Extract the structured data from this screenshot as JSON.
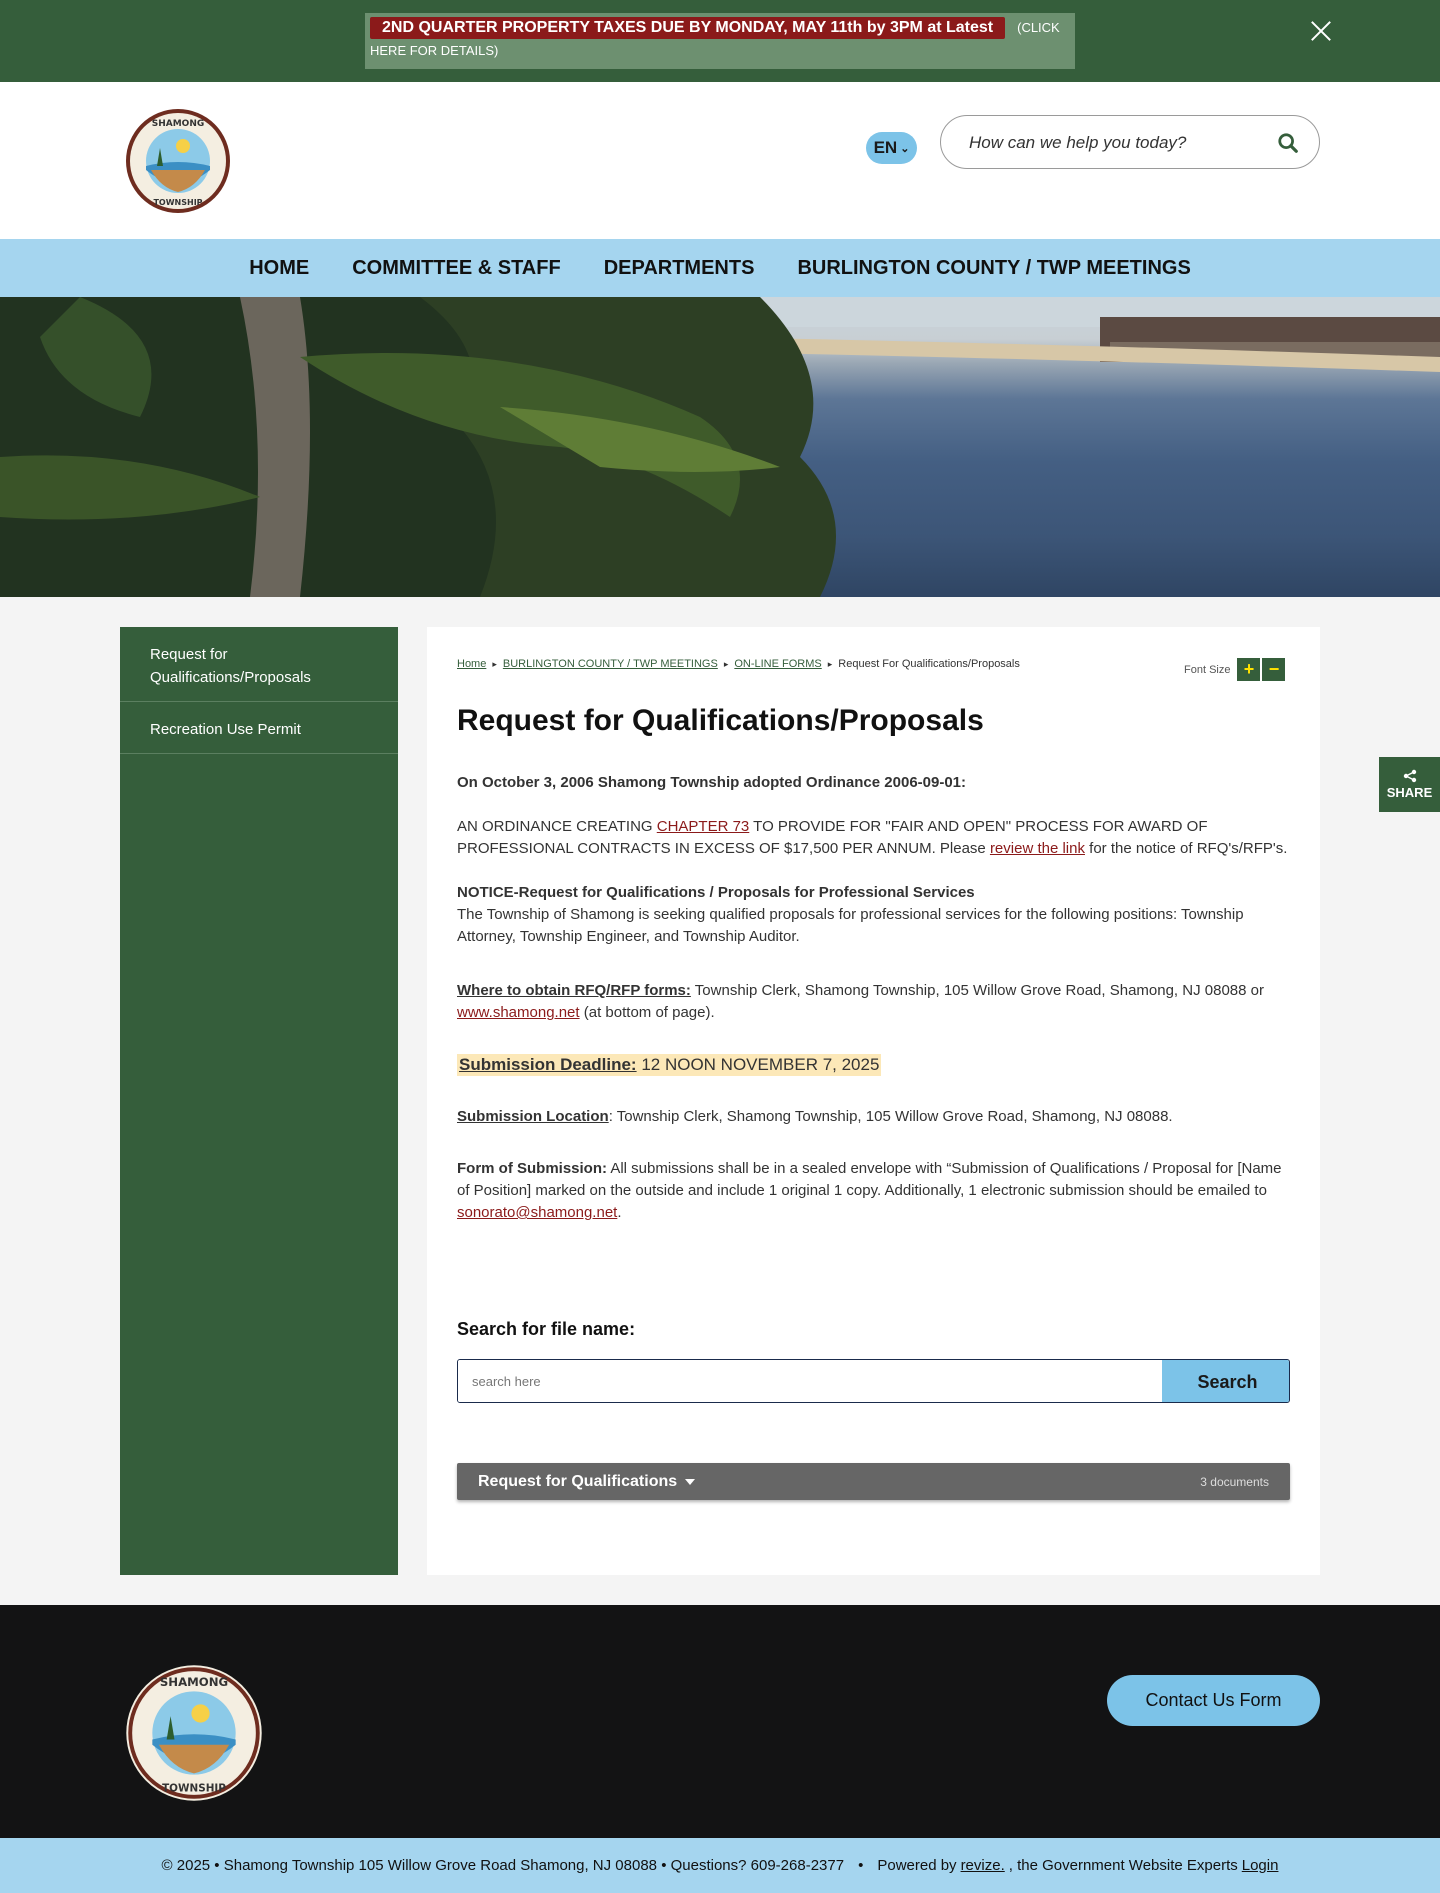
{
  "alert": {
    "badge": "2ND QUARTER PROPERTY TAXES DUE BY MONDAY, MAY 11th by 3PM at Latest",
    "click_text": "(CLICK",
    "line2": "HERE FOR DETAILS)"
  },
  "header": {
    "language": "EN",
    "search_placeholder": "How can we help you today?"
  },
  "nav": {
    "items": [
      "HOME",
      "COMMITTEE & STAFF",
      "DEPARTMENTS",
      "BURLINGTON COUNTY / TWP MEETINGS"
    ]
  },
  "sidebar": {
    "items": [
      "Request for Qualifications/Proposals",
      "Recreation Use Permit"
    ]
  },
  "breadcrumb": {
    "items": [
      "Home",
      "BURLINGTON COUNTY / TWP MEETINGS",
      "ON-LINE FORMS"
    ],
    "current": "Request For Qualifications/Proposals"
  },
  "font_size": {
    "label": "Font Size",
    "plus": "+",
    "minus": "−"
  },
  "page": {
    "title": "Request for Qualifications/Proposals",
    "intro": "On October 3, 2006 Shamong Township adopted Ordinance 2006-09-01:",
    "ord_pre": "AN ORDINANCE CREATING ",
    "ord_link": "CHAPTER 73",
    "ord_mid": " TO PROVIDE FOR \"FAIR AND OPEN\" PROCESS FOR AWARD OF PROFESSIONAL CONTRACTS IN EXCESS OF $17,500 PER ANNUM.  Please ",
    "ord_link2": "review the link",
    "ord_post": " for the notice of RFQ's/RFP's.",
    "notice_heading": "NOTICE-Request for Qualifications / Proposals for Professional Services",
    "notice_text": "The Township of Shamong is seeking qualified proposals for professional services for the following positions:  Township Attorney, Township Engineer, and Township Auditor.",
    "where_label": "Where to obtain RFQ/RFP forms:",
    "where_text": "  Township Clerk, Shamong Township, 105 Willow Grove Road, Shamong, NJ 08088 or ",
    "where_link": "www.shamong.net",
    "where_post": " (at bottom of page).",
    "deadline_label": "Submission Deadline:",
    "deadline_value": "  12 NOON NOVEMBER 7, 2025",
    "location_label": "Submission Location",
    "location_text": ":  Township Clerk, Shamong Township, 105 Willow Grove Road, Shamong, NJ 08088.",
    "form_label": "Form of Submission:",
    "form_text": "  All submissions shall be in a sealed envelope with “Submission of Qualifications / Proposal for [Name of Position] marked on the outside and include 1 original 1 copy.  Additionally, 1 electronic submission should be emailed to ",
    "form_link": "sonorato@shamong.net",
    "form_post": "."
  },
  "file_search": {
    "label": "Search for file name:",
    "placeholder": "search here",
    "button": "Search"
  },
  "accordion": {
    "title": "Request for Qualifications",
    "count": "3 documents"
  },
  "share": {
    "label": "SHARE"
  },
  "footer": {
    "contact_button": "Contact Us Form",
    "copyright": "© 2025 • Shamong Township 105 Willow Grove Road Shamong, NJ 08088 • Questions? 609-268-2377",
    "dot": "•",
    "powered_pre": "Powered by",
    "powered_link": "revize.",
    "powered_post": ", the Government Website Experts",
    "login": "Login"
  },
  "seal": {
    "top_text": "SHAMONG",
    "bottom_text": "TOWNSHIP"
  },
  "colors": {
    "brand_green": "#355e3b",
    "nav_blue": "#a5d5ef",
    "accent_blue": "#7cc3e8",
    "alert_red": "#8b1a1a",
    "footer_dark": "#131314"
  }
}
